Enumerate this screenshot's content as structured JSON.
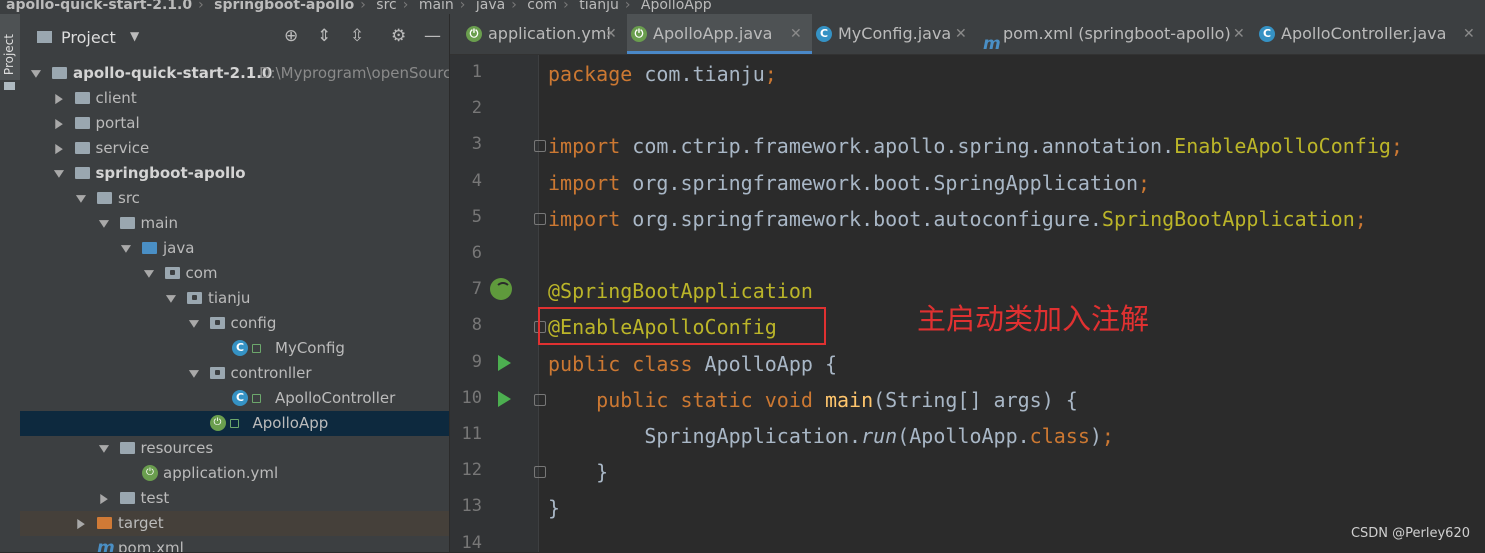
{
  "breadcrumb": {
    "items": [
      "apollo-quick-start-2.1.0",
      "springboot-apollo",
      "src",
      "main",
      "java",
      "com",
      "tianju",
      "ApolloApp"
    ]
  },
  "left_strip": {
    "tab_label": "Project"
  },
  "project_panel": {
    "title": "Project",
    "tree": [
      {
        "label": "apollo-quick-start-2.1.0",
        "path": "D:\\Myprogram\\openSourc",
        "level": 0,
        "icon": "folder-icon",
        "expanded": true,
        "bold": true
      },
      {
        "label": "client",
        "level": 1,
        "icon": "folder-icon",
        "expanded": false
      },
      {
        "label": "portal",
        "level": 1,
        "icon": "folder-icon",
        "expanded": false
      },
      {
        "label": "service",
        "level": 1,
        "icon": "folder-icon",
        "expanded": false
      },
      {
        "label": "springboot-apollo",
        "level": 1,
        "icon": "folder-icon",
        "expanded": true,
        "bold": true
      },
      {
        "label": "src",
        "level": 2,
        "icon": "folder-icon",
        "expanded": true
      },
      {
        "label": "main",
        "level": 3,
        "icon": "folder-icon",
        "expanded": true
      },
      {
        "label": "java",
        "level": 4,
        "icon": "source-folder-icon",
        "expanded": true
      },
      {
        "label": "com",
        "level": 5,
        "icon": "package-icon",
        "expanded": true
      },
      {
        "label": "tianju",
        "level": 6,
        "icon": "package-icon",
        "expanded": true
      },
      {
        "label": "config",
        "level": 7,
        "icon": "package-icon",
        "expanded": true
      },
      {
        "label": "MyConfig",
        "level": 8,
        "icon": "class-icon"
      },
      {
        "label": "contronller",
        "level": 7,
        "icon": "package-icon",
        "expanded": true
      },
      {
        "label": "ApolloController",
        "level": 8,
        "icon": "class-icon"
      },
      {
        "label": "ApolloApp",
        "level": 7,
        "icon": "spring-boot-class-icon",
        "selected": true
      },
      {
        "label": "resources",
        "level": 3,
        "icon": "resources-folder-icon",
        "expanded": true
      },
      {
        "label": "application.yml",
        "level": 4,
        "icon": "yaml-spring-icon"
      },
      {
        "label": "test",
        "level": 3,
        "icon": "folder-icon",
        "expanded": false
      },
      {
        "label": "target",
        "level": 2,
        "icon": "excluded-folder-icon",
        "expanded": false,
        "excluded": true
      },
      {
        "label": "pom.xml",
        "level": 2,
        "icon": "maven-icon"
      }
    ]
  },
  "tabs": [
    {
      "label": "application.yml",
      "icon": "yaml-spring-icon",
      "active": false
    },
    {
      "label": "ApolloApp.java",
      "icon": "spring-boot-class-icon",
      "active": true
    },
    {
      "label": "MyConfig.java",
      "icon": "class-icon",
      "active": false
    },
    {
      "label": "pom.xml (springboot-apollo)",
      "icon": "maven-icon",
      "active": false
    },
    {
      "label": "ApolloController.java",
      "icon": "class-icon",
      "active": false
    }
  ],
  "editor": {
    "line_numbers": [
      "1",
      "2",
      "3",
      "4",
      "5",
      "6",
      "7",
      "8",
      "9",
      "10",
      "11",
      "12",
      "13",
      "14"
    ],
    "lines": [
      [
        {
          "t": "package ",
          "c": "kw"
        },
        {
          "t": "com.tianju",
          "c": "plain"
        },
        {
          "t": ";",
          "c": "kw"
        }
      ],
      [],
      [
        {
          "t": "import ",
          "c": "kw"
        },
        {
          "t": "com.ctrip.framework.apollo.spring.annotation.",
          "c": "plain"
        },
        {
          "t": "EnableApolloConfig",
          "c": "ann"
        },
        {
          "t": ";",
          "c": "kw"
        }
      ],
      [
        {
          "t": "import ",
          "c": "kw"
        },
        {
          "t": "org.springframework.boot.SpringApplication",
          "c": "plain"
        },
        {
          "t": ";",
          "c": "kw"
        }
      ],
      [
        {
          "t": "import ",
          "c": "kw"
        },
        {
          "t": "org.springframework.boot.autoconfigure.",
          "c": "plain"
        },
        {
          "t": "SpringBootApplication",
          "c": "ann"
        },
        {
          "t": ";",
          "c": "kw"
        }
      ],
      [],
      [
        {
          "t": "@SpringBootApplication",
          "c": "ann"
        }
      ],
      [
        {
          "t": "@EnableApolloConfig",
          "c": "ann"
        }
      ],
      [
        {
          "t": "public class ",
          "c": "kw"
        },
        {
          "t": "ApolloApp {",
          "c": "plain"
        }
      ],
      [
        {
          "t": "    public static void ",
          "c": "kw"
        },
        {
          "t": "main",
          "c": "fn"
        },
        {
          "t": "(String[] args) {",
          "c": "plain"
        }
      ],
      [
        {
          "t": "        SpringApplication.",
          "c": "plain"
        },
        {
          "t": "run",
          "c": "it"
        },
        {
          "t": "(ApolloApp.",
          "c": "plain"
        },
        {
          "t": "class",
          "c": "kw"
        },
        {
          "t": ")",
          "c": "plain"
        },
        {
          "t": ";",
          "c": "kw"
        }
      ],
      [
        {
          "t": "    }",
          "c": "plain"
        }
      ],
      [
        {
          "t": "}",
          "c": "plain"
        }
      ],
      []
    ]
  },
  "annotation_text": "主启动类加入注解",
  "watermark": "CSDN @Perley620",
  "colors": {
    "keyword": "#cc7832",
    "annotation": "#bbb529",
    "highlight_box": "#e03131"
  }
}
